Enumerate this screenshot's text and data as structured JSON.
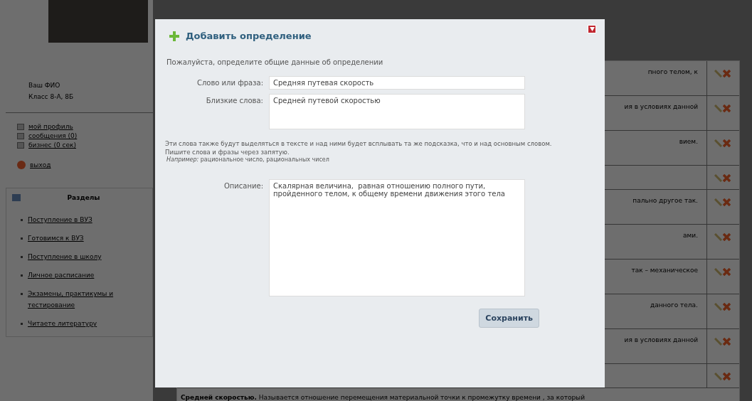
{
  "sidebar": {
    "user_lines": [
      "Ваш ФИО",
      "Класс 8-А, 8Б"
    ],
    "links": [
      {
        "label": "мой профиль"
      },
      {
        "label": "сообщения (0)"
      },
      {
        "label": "бизнес (0 сек)"
      }
    ],
    "logout": "выход",
    "sections_title": "Разделы",
    "sections": [
      {
        "label": "Поступление в ВУЗ"
      },
      {
        "label": "Готовимся к ВУЗ"
      },
      {
        "label": "Поступление в школу"
      },
      {
        "label": "Личное расписание"
      },
      {
        "label": "Экзамены, практикумы и тестирование"
      },
      {
        "label": "Читаете литературу"
      }
    ]
  },
  "table": {
    "rows": [
      {
        "text": "пного телом, к"
      },
      {
        "text": "ия в условиях данной"
      },
      {
        "text": "вием."
      },
      {
        "text": ""
      },
      {
        "text": "пально другое так."
      },
      {
        "text": "ами."
      },
      {
        "text": "так – механическое"
      },
      {
        "text": "данного тела."
      },
      {
        "text": "ия в условиях данной"
      },
      {
        "text": ""
      }
    ],
    "last_row": "**Средней скоростью.** Называется отношение перемещения материальной точки к промежутку времени , за который"
  },
  "dialog": {
    "title": "Добавить определение",
    "intro": "Пожалуйста, определите общие данные об определении",
    "word": {
      "label": "Слово или фраза:",
      "value": "Средняя путевая скорость"
    },
    "synonyms": {
      "label": "Близкие слова:",
      "value": "Средней путевой скоростью"
    },
    "hint": "Эти слова также будут выделяться в тексте и над ними будет всплывать та же подсказка, что и над основным словом. Пишите слова и фразы через запятую.",
    "example": "*Например:* рациональное число, рациональных чисел",
    "description": {
      "label": "Описание:",
      "value": "Скалярная величина,  равная отношению полного пути, пройденного телом, к общему времени движения этого тела"
    },
    "save_button": "Сохранить"
  }
}
